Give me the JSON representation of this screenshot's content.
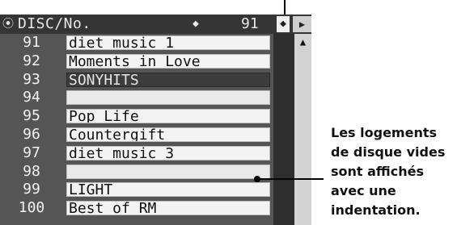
{
  "header": {
    "icon": "disc-icon",
    "title": "DISC/No.",
    "left_arrow": "◆",
    "number": "91",
    "right_arrow": "◆",
    "scroll_right": "▶"
  },
  "rows": [
    {
      "num": "91",
      "title": "diet music 1",
      "state": "normal"
    },
    {
      "num": "92",
      "title": "Moments in Love",
      "state": "normal"
    },
    {
      "num": "93",
      "title": "SONYHITS",
      "state": "selected"
    },
    {
      "num": "94",
      "title": "",
      "state": "empty"
    },
    {
      "num": "95",
      "title": "Pop Life",
      "state": "normal"
    },
    {
      "num": "96",
      "title": "Countergift",
      "state": "normal"
    },
    {
      "num": "97",
      "title": "diet music 3",
      "state": "normal"
    },
    {
      "num": "98",
      "title": "",
      "state": "empty"
    },
    {
      "num": "99",
      "title": "LIGHT",
      "state": "normal"
    },
    {
      "num": "100",
      "title": "Best of RM",
      "state": "normal"
    }
  ],
  "scroll": {
    "up": "▲",
    "down": "▼"
  },
  "caption": [
    "Les logements",
    "de disque vides",
    "sont affichés",
    "avec une",
    "indentation."
  ]
}
